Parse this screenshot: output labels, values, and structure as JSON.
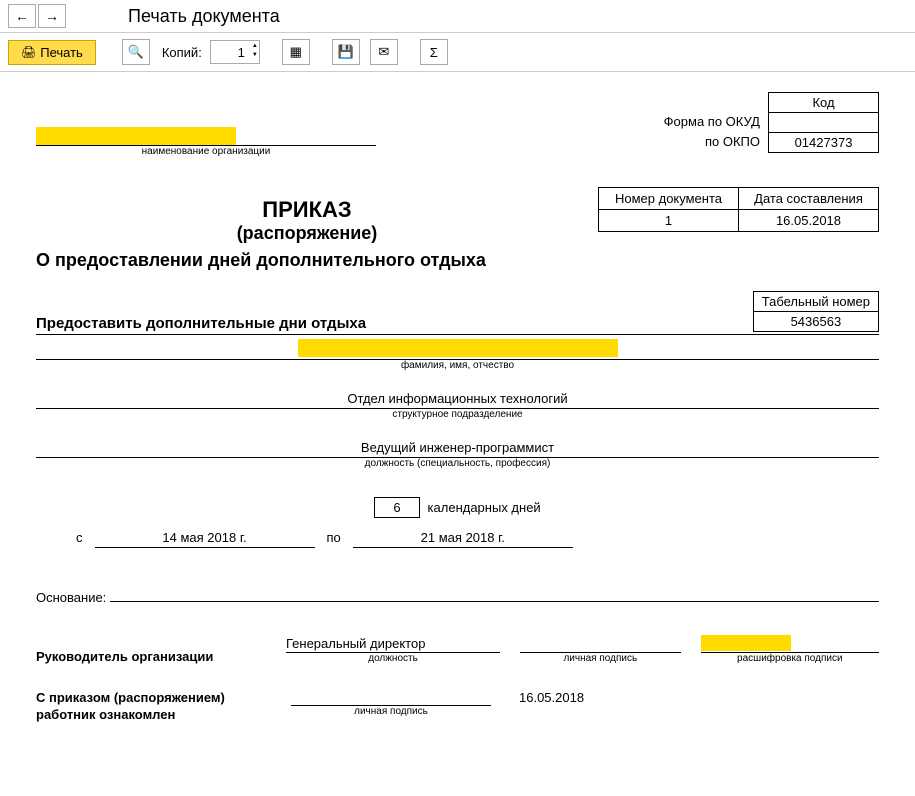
{
  "nav": {
    "title": "Печать документа"
  },
  "toolbar": {
    "print_label": "Печать",
    "copies_label": "Копий:",
    "copies_value": "1"
  },
  "doc": {
    "code_header": "Код",
    "form_okud_label": "Форма по ОКУД",
    "form_okpo_label": "по ОКПО",
    "okud_value": "",
    "okpo_value": "01427373",
    "org_name_label": "наименование организации",
    "num_header": "Номер документа",
    "date_header": "Дата составления",
    "doc_number": "1",
    "doc_date": "16.05.2018",
    "title_1": "ПРИКАЗ",
    "title_2": "(распоряжение)",
    "subtitle": "О предоставлении дней дополнительного отдыха",
    "provide_text": "Предоставить дополнительные дни отдыха",
    "tabel_header": "Табельный номер",
    "tabel_value": "5436563",
    "fio_label": "фамилия, имя, отчество",
    "dept_value": "Отдел информационных технологий",
    "dept_label": "структурное подразделение",
    "position_value": "Ведущий инженер-программист",
    "position_label": "должность (специальность, профессия)",
    "days_value": "6",
    "days_label": "календарных дней",
    "from_label": "с",
    "to_label": "по",
    "date_from": "14 мая 2018 г.",
    "date_to": "21 мая 2018 г.",
    "basis_label": "Основание:",
    "head_label": "Руководитель организации",
    "head_position": "Генеральный директор",
    "sig_position_label": "должность",
    "sig_sign_label": "личная подпись",
    "sig_name_label": "расшифровка подписи",
    "ack_label_1": "С приказом (распоряжением)",
    "ack_label_2": "работник  ознакомлен",
    "ack_date": "16.05.2018"
  }
}
